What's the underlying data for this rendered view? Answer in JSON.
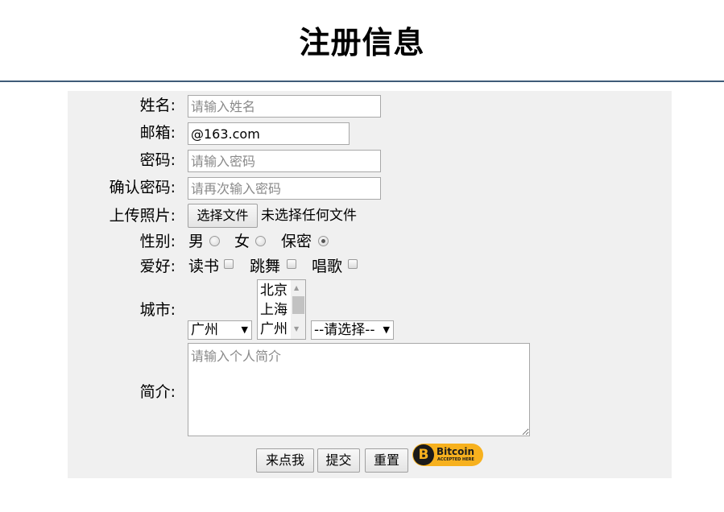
{
  "page": {
    "title": "注册信息"
  },
  "form": {
    "name": {
      "label": "姓名:",
      "placeholder": "请输入姓名",
      "value": ""
    },
    "email": {
      "label": "邮箱:",
      "value": "@163.com"
    },
    "password": {
      "label": "密码:",
      "placeholder": "请输入密码"
    },
    "confirm": {
      "label": "确认密码:",
      "placeholder": "请再次输入密码"
    },
    "photo": {
      "label": "上传照片:",
      "button": "选择文件",
      "status": "未选择任何文件"
    },
    "gender": {
      "label": "性别:",
      "options": [
        "男",
        "女",
        "保密"
      ],
      "selected": "保密"
    },
    "hobby": {
      "label": "爱好:",
      "options": [
        "读书",
        "跳舞",
        "唱歌"
      ]
    },
    "city": {
      "label": "城市:",
      "select1": "广州",
      "list": [
        "北京",
        "上海",
        "广州"
      ],
      "select3": "--请选择--"
    },
    "intro": {
      "label": "简介:",
      "placeholder": "请输入个人简介"
    },
    "buttons": {
      "click_me": "来点我",
      "submit": "提交",
      "reset": "重置"
    },
    "badge": {
      "coin_symbol": "B",
      "word": "Bitcoin",
      "small": "ACCEPTED HERE"
    }
  },
  "icons": {
    "select_arrow": "▼",
    "scroll_up": "▲",
    "scroll_down": "▼"
  }
}
